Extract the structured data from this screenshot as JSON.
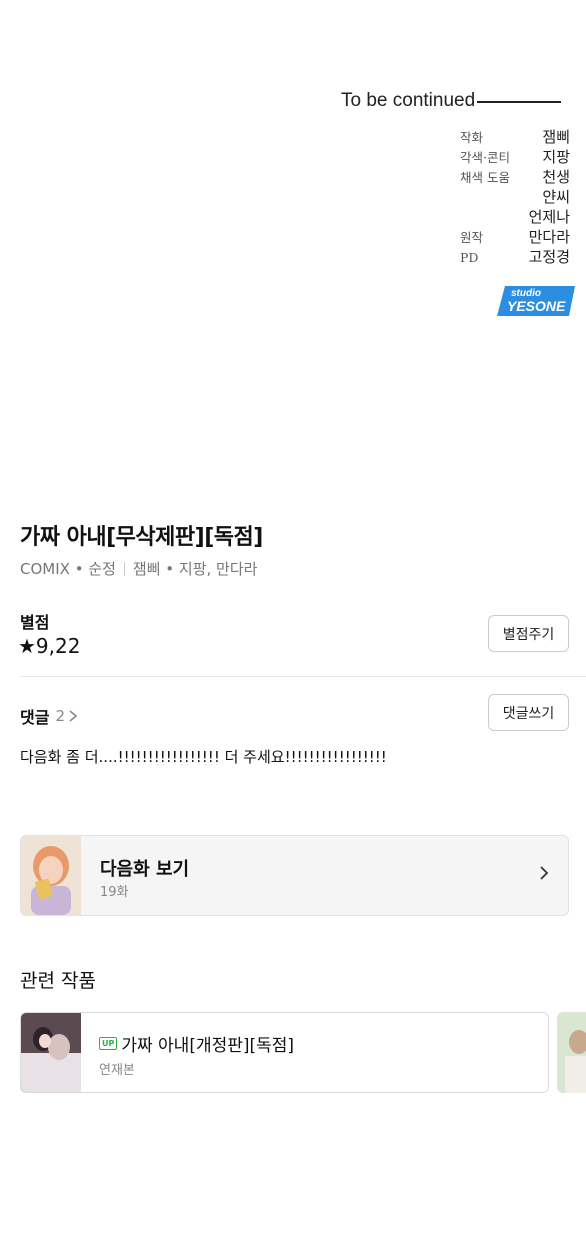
{
  "credits": {
    "to_be_continued": "To be continued",
    "rows": [
      {
        "role": "작화",
        "name": "잼삐"
      },
      {
        "role": "각색·콘티",
        "name": "지팡"
      },
      {
        "role": "채색 도움",
        "name": "천생"
      },
      {
        "role": "",
        "name": "얀씨"
      },
      {
        "role": "",
        "name": "언제나"
      },
      {
        "role": "원작",
        "name": "만다라"
      },
      {
        "role": "PD",
        "name": "고정경"
      }
    ],
    "studio_logo": {
      "small": "studio",
      "big": "YESONE",
      "color": "#2b8ee0"
    }
  },
  "work": {
    "title": "가짜 아내[무삭제판][독점]",
    "label": "COMIX",
    "genre": "순정",
    "authors": "잼삐 • 지팡, 만다라"
  },
  "rating": {
    "label": "별점",
    "value": "★9,22",
    "button": "별점주기"
  },
  "comments": {
    "label": "댓글",
    "count": "2",
    "button": "댓글쓰기",
    "latest": "다음화 좀 더....!!!!!!!!!!!!!!!!! 더 주세요!!!!!!!!!!!!!!!!!"
  },
  "next_episode": {
    "title": "다음화 보기",
    "episode": "19화"
  },
  "related": {
    "heading": "관련 작품",
    "items": [
      {
        "badge": "UP",
        "title": "가짜 아내[개정판][독점]",
        "status": "연재본"
      }
    ]
  },
  "colors": {
    "accent_green": "#2cb34a",
    "logo_blue": "#2b8ee0"
  }
}
